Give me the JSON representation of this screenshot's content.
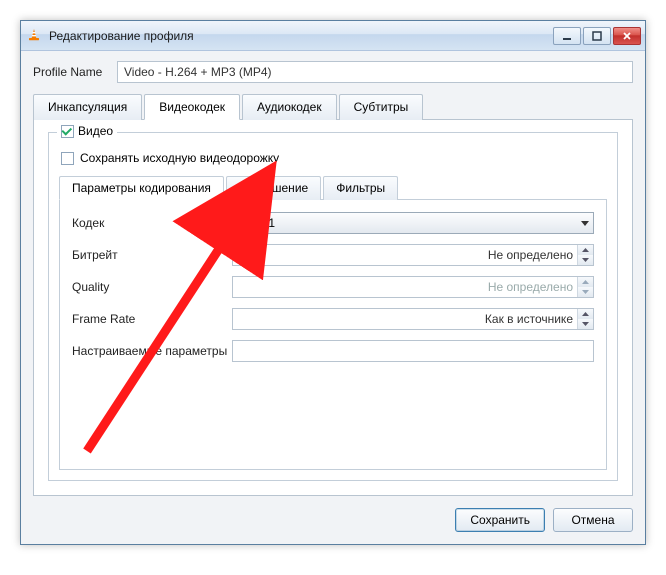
{
  "window": {
    "title": "Редактирование профиля"
  },
  "profile": {
    "label": "Profile Name",
    "value": "Video - H.264 + MP3 (MP4)"
  },
  "tabs": {
    "encapsulation": "Инкапсуляция",
    "videocodec": "Видеокодек",
    "audiocodec": "Аудиокодек",
    "subtitles": "Субтитры"
  },
  "video": {
    "enable_label": "Видео",
    "keep_original_label": "Сохранять исходную видеодорожку",
    "subtabs": {
      "params": "Параметры кодирования",
      "resolution": "Разрешение",
      "filters": "Фильтры"
    },
    "fields": {
      "codec_label": "Кодек",
      "codec_value": "WMV1",
      "bitrate_label": "Битрейт",
      "bitrate_value": "Не определено",
      "quality_label": "Quality",
      "quality_value": "Не определено",
      "framerate_label": "Frame Rate",
      "framerate_value": "Как в источнике",
      "custom_label": "Настраиваемые параметры",
      "custom_value": ""
    }
  },
  "buttons": {
    "save": "Сохранить",
    "cancel": "Отмена"
  }
}
